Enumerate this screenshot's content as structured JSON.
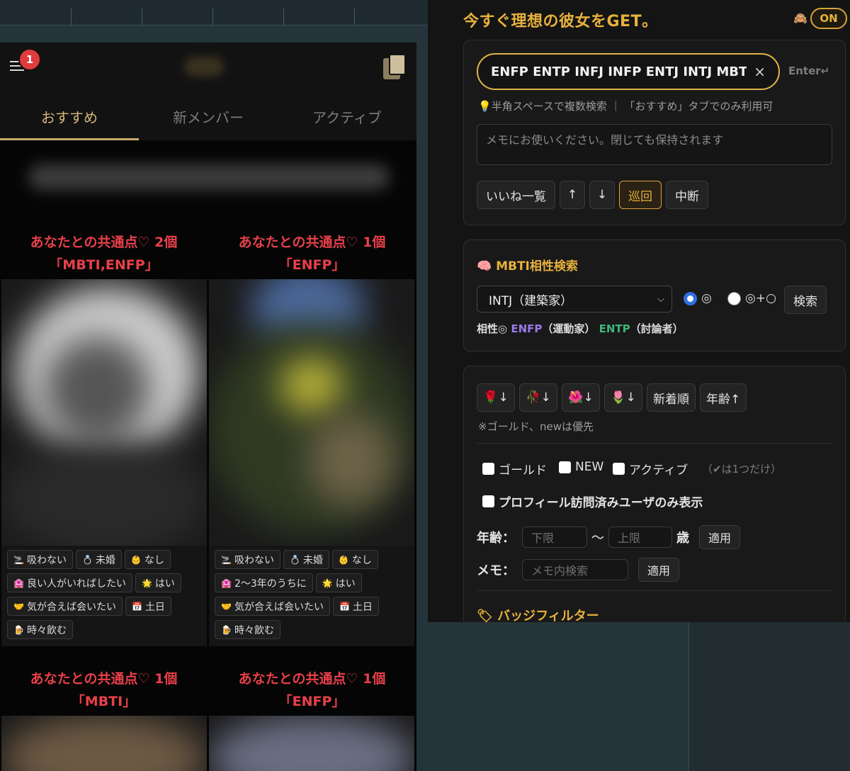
{
  "phone": {
    "notification_count": "1",
    "tabs": [
      "おすすめ",
      "新メンバー",
      "アクティブ"
    ],
    "active_tab": 0,
    "cards": [
      {
        "common": "あなたとの共通点♡ 2個",
        "common_items": "「MBTI,ENFP」",
        "tags": [
          {
            "icon": "🚬",
            "label": "吸わない"
          },
          {
            "icon": "💍",
            "label": "未婚"
          },
          {
            "icon": "👶",
            "label": "なし"
          },
          {
            "icon": "🏩",
            "label": "良い人がいればしたい"
          },
          {
            "icon": "🌟",
            "label": "はい"
          },
          {
            "icon": "🤝",
            "label": "気が合えば会いたい"
          },
          {
            "icon": "📅",
            "label": "土日"
          },
          {
            "icon": "🍺",
            "label": "時々飲む"
          }
        ]
      },
      {
        "common": "あなたとの共通点♡ 1個",
        "common_items": "「ENFP」",
        "tags": [
          {
            "icon": "🚬",
            "label": "吸わない"
          },
          {
            "icon": "💍",
            "label": "未婚"
          },
          {
            "icon": "👶",
            "label": "なし"
          },
          {
            "icon": "🏩",
            "label": "2〜3年のうちに"
          },
          {
            "icon": "🌟",
            "label": "はい"
          },
          {
            "icon": "🤝",
            "label": "気が合えば会いたい"
          },
          {
            "icon": "📅",
            "label": "土日"
          },
          {
            "icon": "🍺",
            "label": "時々飲む"
          }
        ]
      },
      {
        "common": "あなたとの共通点♡ 1個",
        "common_items": "「MBTI」"
      },
      {
        "common": "あなたとの共通点♡ 1個",
        "common_items": "「ENFP」"
      }
    ]
  },
  "panel": {
    "title": "今すぐ理想の彼女をGET。",
    "toggle_label": "ON",
    "search": {
      "value": "ENFP ENTP INFJ INFP ENTJ INTJ MBT",
      "clear": "×",
      "enter_hint": "Enter↵",
      "hint": "💡半角スペースで複数検索 ｜ 「おすすめ」タブでのみ利用可"
    },
    "memo_placeholder": "メモにお使いください。閉じても保持されます",
    "buttons": {
      "likes": "いいね一覧",
      "up": "↑",
      "down": "↓",
      "patrol": "巡回",
      "stop": "中断"
    },
    "mbti": {
      "title": "🧠 MBTI相性検索",
      "selected": "INTJ（建築家）",
      "radio1": "◎",
      "radio2": "◎+○",
      "search": "検索",
      "compat_prefix": "相性◎",
      "enfp": "ENFP",
      "enfp_desc": "（運動家）",
      "entp": "ENTP",
      "entp_desc": "（討論者）"
    },
    "sort": {
      "buttons": [
        "🌹↓",
        "🥀↓",
        "🌺↓",
        "🌷↓",
        "新着順",
        "年齢↑"
      ],
      "note": "※ゴールド、newは優先"
    },
    "filters": {
      "gold": "ゴールド",
      "new": "NEW",
      "active": "アクティブ",
      "note": "（✔は1つだけ）",
      "visited": "プロフィール訪問済みユーザのみ表示",
      "age_label": "年齢：",
      "min_placeholder": "下限",
      "tilde": "〜",
      "max_placeholder": "上限",
      "age_unit": "歳",
      "apply": "適用",
      "memo_label": "メモ：",
      "memo_placeholder": "メモ内検索"
    },
    "badge_title": "🏷 バッジフィルター"
  },
  "colors": {
    "accent_gold": "#e7b13c",
    "common_red": "#e8404a",
    "enfp_purple": "#9a79e6",
    "entp_green": "#3fb57a",
    "radio_blue": "#2f6fe4"
  }
}
